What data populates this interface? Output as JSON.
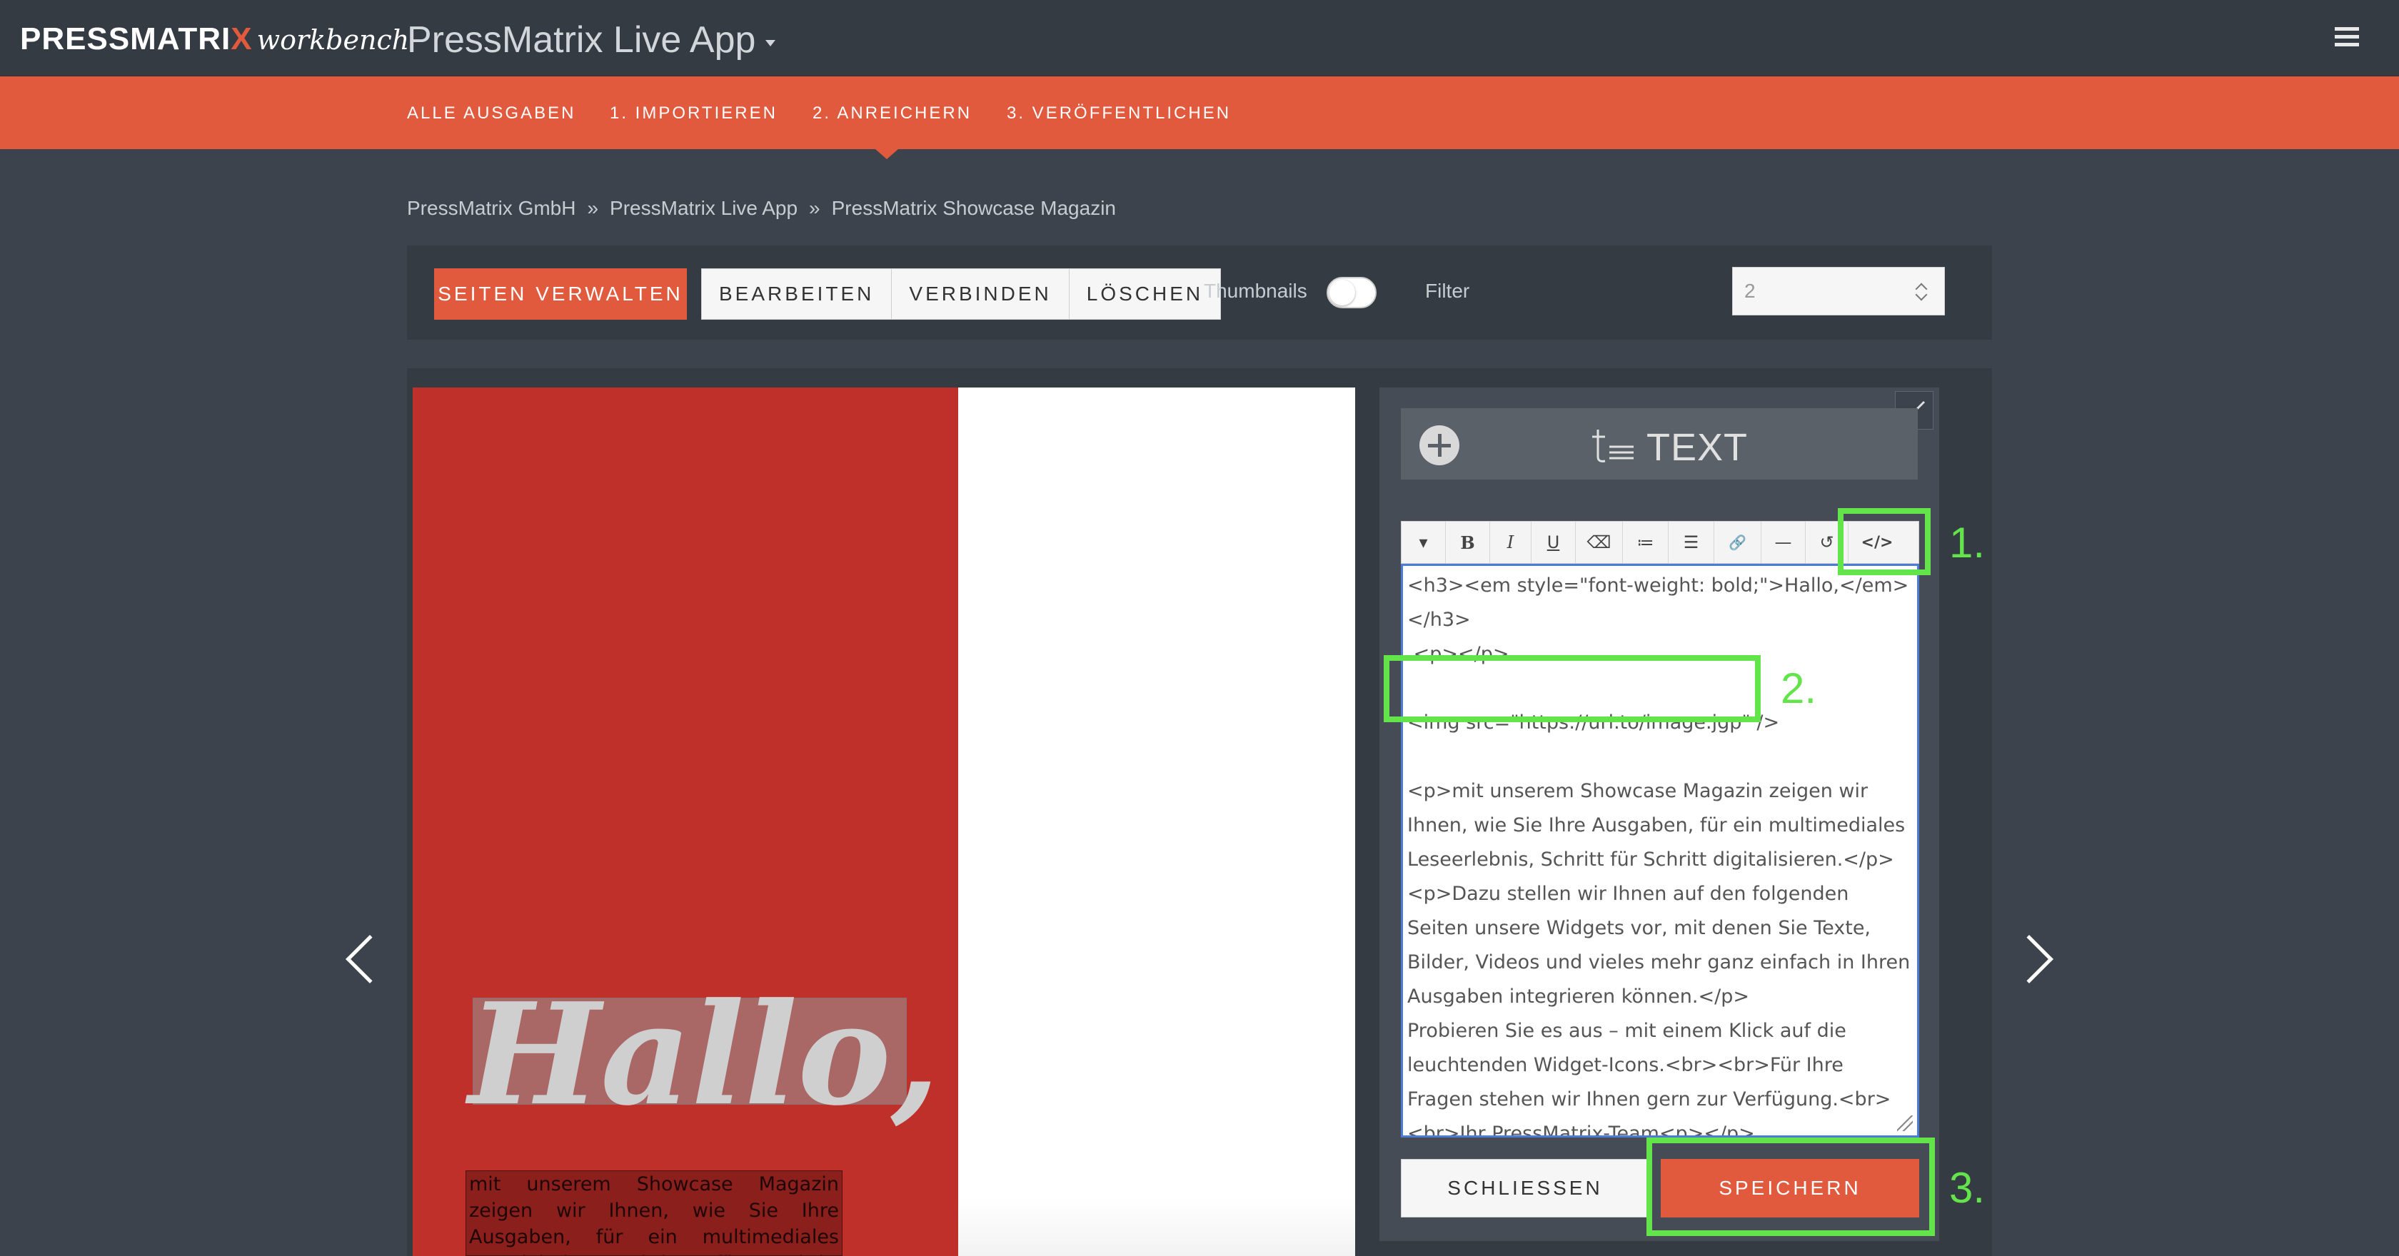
{
  "header": {
    "brand_main": "PRESSMATRI",
    "brand_x": "X",
    "brand_sub": "workbench",
    "app_title": "PressMatrix Live App"
  },
  "nav": {
    "items": [
      {
        "label": "ALLE AUSGABEN"
      },
      {
        "label": "1. IMPORTIEREN"
      },
      {
        "label": "2. ANREICHERN"
      },
      {
        "label": "3. VERÖFFENTLICHEN"
      }
    ]
  },
  "breadcrumb": {
    "items": [
      "PressMatrix GmbH",
      "PressMatrix Live App",
      "PressMatrix Showcase Magazin"
    ],
    "separator": "»"
  },
  "toolbar": {
    "manage_label": "SEITEN VERWALTEN",
    "edit_label": "BEARBEITEN",
    "connect_label": "VERBINDEN",
    "delete_label": "LÖSCHEN",
    "thumbnails_label": "Thumbnails",
    "thumbnails_on": false,
    "filter_label": "Filter",
    "page_number": "2"
  },
  "page_preview": {
    "headline": "Hallo,",
    "body": "mit unserem Showcase Magazin zeigen wir Ihnen, wie Sie Ihre Ausgaben, für ein multimediales Leserlebnis, Schritt für Schritt digitalisieren."
  },
  "widget": {
    "type_label": "TEXT",
    "toolbar_buttons": [
      {
        "name": "style-dropdown",
        "glyph": "▾"
      },
      {
        "name": "bold",
        "glyph": "B"
      },
      {
        "name": "italic",
        "glyph": "I"
      },
      {
        "name": "underline",
        "glyph": "U"
      },
      {
        "name": "eraser",
        "glyph": "⌫"
      },
      {
        "name": "bullet-list",
        "glyph": "≔"
      },
      {
        "name": "numbered-list",
        "glyph": "☰"
      },
      {
        "name": "link",
        "glyph": "🔗"
      },
      {
        "name": "horizontal-rule",
        "glyph": "—"
      },
      {
        "name": "undo",
        "glyph": "↺"
      },
      {
        "name": "code-view",
        "glyph": "</>"
      }
    ],
    "editor_lines": {
      "l1": "<h3><em style=\"font-weight: bold;\">Hallo,</em></h3>",
      "l2": " <p></p>",
      "l3": "",
      "l4": "<img src=\"https://url.to/image.jgp\" />",
      "l5": "",
      "l6": "<p>mit unserem Showcase Magazin zeigen wir Ihnen, wie Sie Ihre Ausgaben, für ein multimediales Leseerlebnis, Schritt für Schritt digitalisieren.</p><p>Dazu stellen wir Ihnen auf den folgenden Seiten unsere Widgets vor, mit denen Sie Texte, Bilder, Videos und vieles mehr ganz einfach in Ihren Ausgaben integrieren können.</p>",
      "l7": "Probieren Sie es aus – mit einem Klick auf die leuchtenden Widget-Icons.<br><br>Für Ihre Fragen stehen wir Ihnen gern zur Verfügung.<br><br>Ihr PressMatrix-Team<p></p>"
    },
    "close_label": "SCHLIESSEN",
    "save_label": "SPEICHERN"
  },
  "annotations": {
    "step1": "1.",
    "step2": "2.",
    "step3": "3.",
    "highlight_color": "#62e44a"
  },
  "colors": {
    "accent": "#e25a3e",
    "header_bg": "#353b43",
    "page_bg": "#3c434c",
    "magazine_red": "#c0302a"
  }
}
